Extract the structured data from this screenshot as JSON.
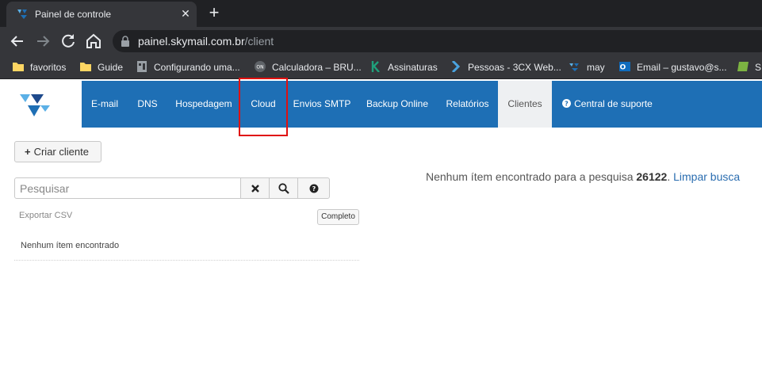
{
  "browser": {
    "tab": {
      "title": "Painel de controle",
      "close": "✕"
    },
    "new_tab": "+",
    "url": {
      "host": "painel.skymail.com.br",
      "path": "/client"
    },
    "bookmarks": [
      {
        "label": "favoritos",
        "icon": "folder-icon"
      },
      {
        "label": "Guide",
        "icon": "folder-icon"
      },
      {
        "label": "Configurando uma...",
        "icon": "page-icon"
      },
      {
        "label": "Calculadora – BRU...",
        "icon": "calculator-icon"
      },
      {
        "label": "Assinaturas",
        "icon": "k-icon"
      },
      {
        "label": "Pessoas - 3CX Web...",
        "icon": "chevron-icon"
      },
      {
        "label": "may",
        "icon": "skymail-icon"
      },
      {
        "label": "Email – gustavo@s...",
        "icon": "outlook-icon"
      },
      {
        "label": "S",
        "icon": "sheet-icon"
      }
    ]
  },
  "nav": {
    "items": [
      {
        "label": "E-mail"
      },
      {
        "label": "DNS"
      },
      {
        "label": "Hospedagem"
      },
      {
        "label": "Cloud"
      },
      {
        "label": "Envios SMTP"
      },
      {
        "label": "Backup Online"
      },
      {
        "label": "Relatórios"
      },
      {
        "label": "Clientes"
      },
      {
        "label": "Central de suporte"
      }
    ],
    "active": "Clientes"
  },
  "content": {
    "create_button": "Criar cliente",
    "search": {
      "placeholder": "Pesquisar",
      "value": ""
    },
    "export_csv": "Exportar CSV",
    "completo_button": "Completo",
    "empty_list": "Nenhum ítem encontrado",
    "result": {
      "prefix": "Nenhum ítem encontrado para a pesquisa ",
      "term": "26122",
      "suffix": ". ",
      "clear_link": "Limpar busca"
    }
  },
  "colors": {
    "brand_blue": "#1e6fb5",
    "highlight_red": "#e01010"
  }
}
